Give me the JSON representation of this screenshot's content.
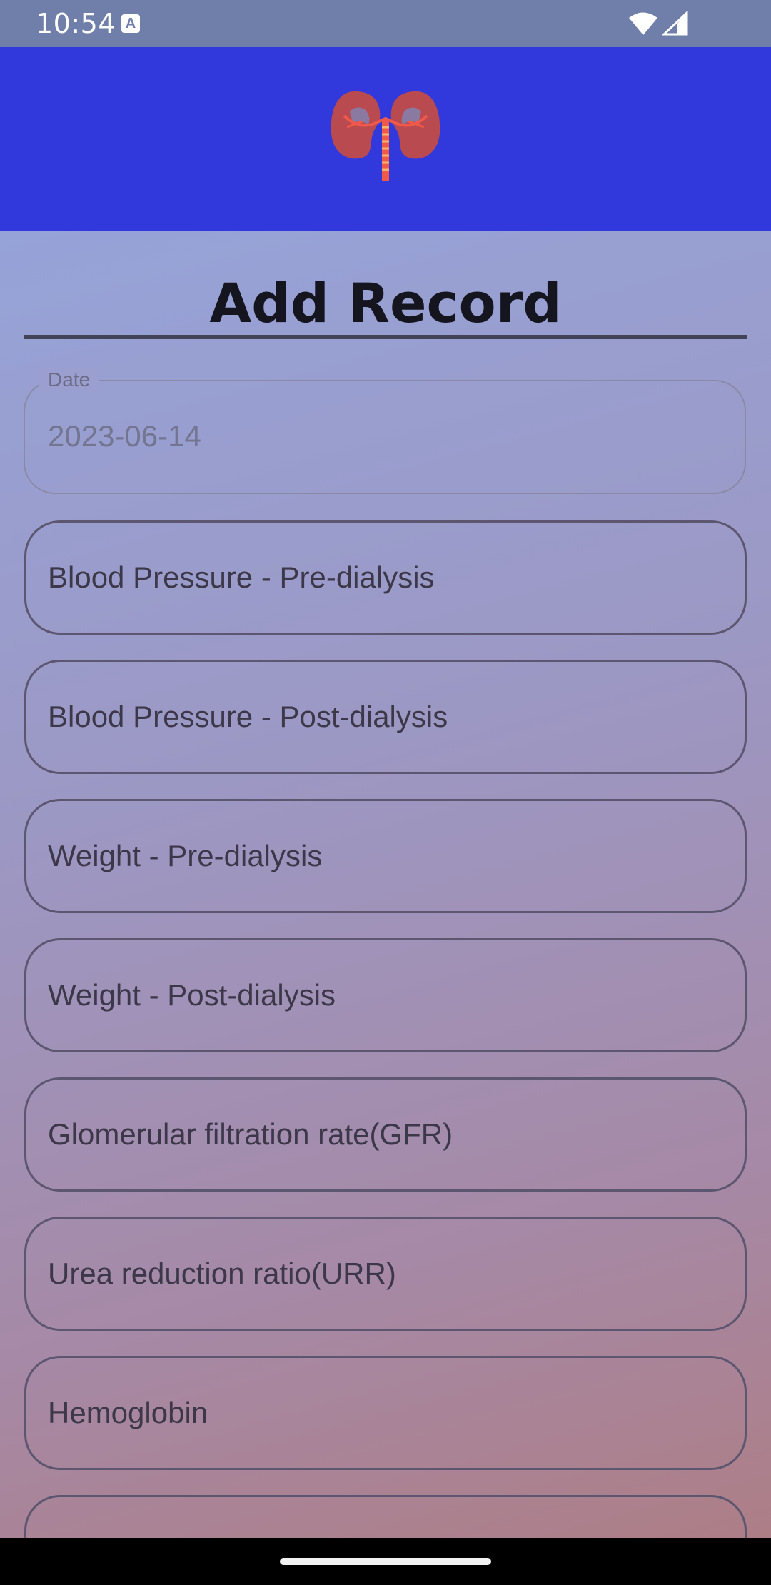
{
  "status_bar": {
    "time": "10:54",
    "app_icon": "A",
    "icons": [
      "wifi-icon",
      "signal-icon"
    ]
  },
  "header": {
    "logo": "kidneys-icon",
    "colors": {
      "background": "#3239dc"
    }
  },
  "form": {
    "title": "Add Record",
    "date": {
      "label": "Date",
      "value": "2023-06-14"
    },
    "fields": [
      {
        "label": "Blood Pressure - Pre-dialysis"
      },
      {
        "label": "Blood Pressure - Post-dialysis"
      },
      {
        "label": "Weight - Pre-dialysis"
      },
      {
        "label": "Weight - Post-dialysis"
      },
      {
        "label": "Glomerular filtration rate(GFR)"
      },
      {
        "label": "Urea reduction ratio(URR)"
      },
      {
        "label": "Hemoglobin"
      },
      {
        "label": ""
      }
    ]
  }
}
